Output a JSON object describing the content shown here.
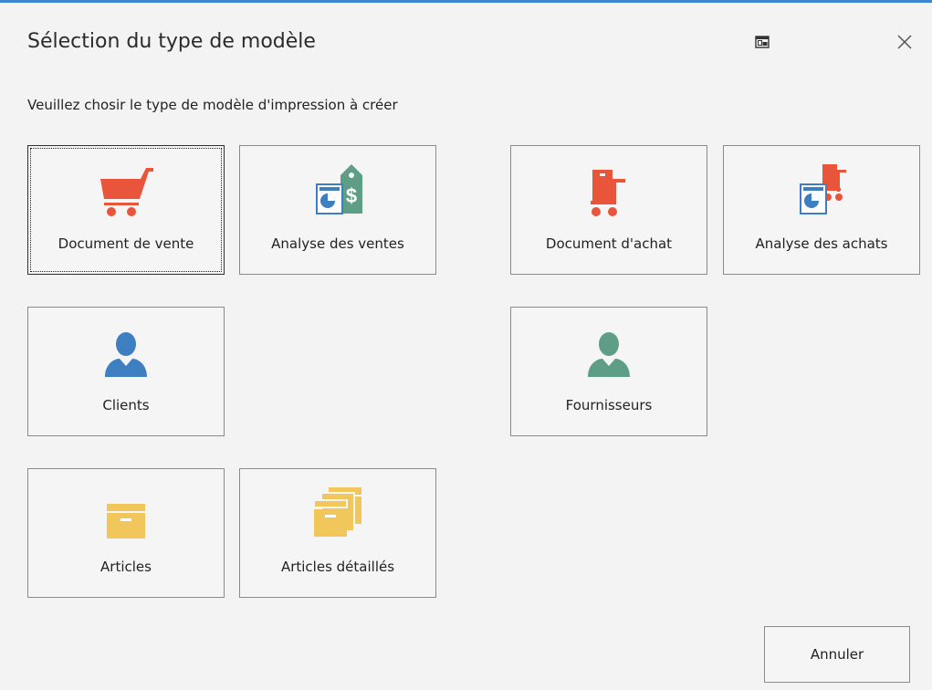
{
  "dialog": {
    "title": "Sélection du type de modèle",
    "subtitle": "Veuillez chosir le type de modèle d'impression à créer"
  },
  "tiles": {
    "sales_doc": {
      "label": "Document de vente",
      "icon": "shopping-cart-icon"
    },
    "sales_analysis": {
      "label": "Analyse des ventes",
      "icon": "sales-report-tag-icon"
    },
    "purchase_doc": {
      "label": "Document d'achat",
      "icon": "hand-truck-icon"
    },
    "purchase_analysis": {
      "label": "Analyse des achats",
      "icon": "purchase-report-icon"
    },
    "clients": {
      "label": "Clients",
      "icon": "user-icon"
    },
    "suppliers": {
      "label": "Fournisseurs",
      "icon": "user-icon"
    },
    "articles": {
      "label": "Articles",
      "icon": "box-icon"
    },
    "articles_detailed": {
      "label": "Articles détaillés",
      "icon": "stacked-boxes-icon"
    }
  },
  "buttons": {
    "cancel": "Annuler"
  },
  "colors": {
    "accent": "#3b86cf",
    "sales": "#e8553b",
    "green": "#5f9e86",
    "blue": "#3e7fc1",
    "box": "#f1c75c"
  }
}
